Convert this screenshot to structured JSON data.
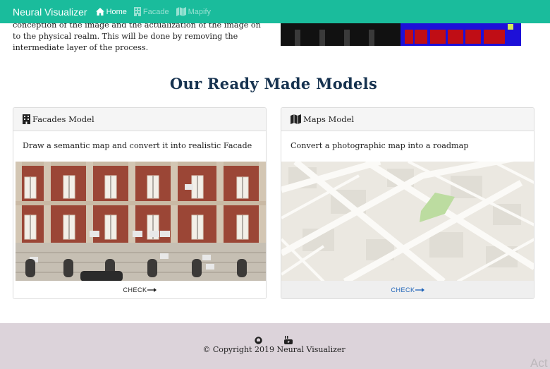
{
  "navbar": {
    "brand": "Neural Visualizer",
    "links": [
      {
        "label": "Home",
        "icon": "home-icon",
        "active": true
      },
      {
        "label": "Facade",
        "icon": "building-icon",
        "active": false
      },
      {
        "label": "Mapify",
        "icon": "map-icon",
        "active": false
      }
    ]
  },
  "intro": {
    "lines": [
      "conception of the image and the actualization of the image on",
      "to the physical realm. This will be done by removing the",
      "intermediate layer of the process."
    ]
  },
  "models_section": {
    "title": "Our Ready Made Models",
    "cards": [
      {
        "title": "Facades Model",
        "icon": "building-icon",
        "description": "Draw a semantic map and convert it into realistic Facade",
        "image": "facade-photo",
        "action": "CHECK"
      },
      {
        "title": "Maps Model",
        "icon": "map-icon",
        "description": "Convert a photographic map into a roadmap",
        "image": "roadmap-image",
        "action": "CHECK"
      }
    ]
  },
  "footer": {
    "social": [
      {
        "icon": "github-icon"
      },
      {
        "icon": "youtube-icon"
      }
    ],
    "copyright": "© Copyright 2019 Neural Visualizer"
  },
  "watermark": "Act",
  "colors": {
    "navbar": "#1abc9c",
    "title": "#16324f",
    "link": "#1e63b8",
    "footer": "#dcd3da"
  }
}
